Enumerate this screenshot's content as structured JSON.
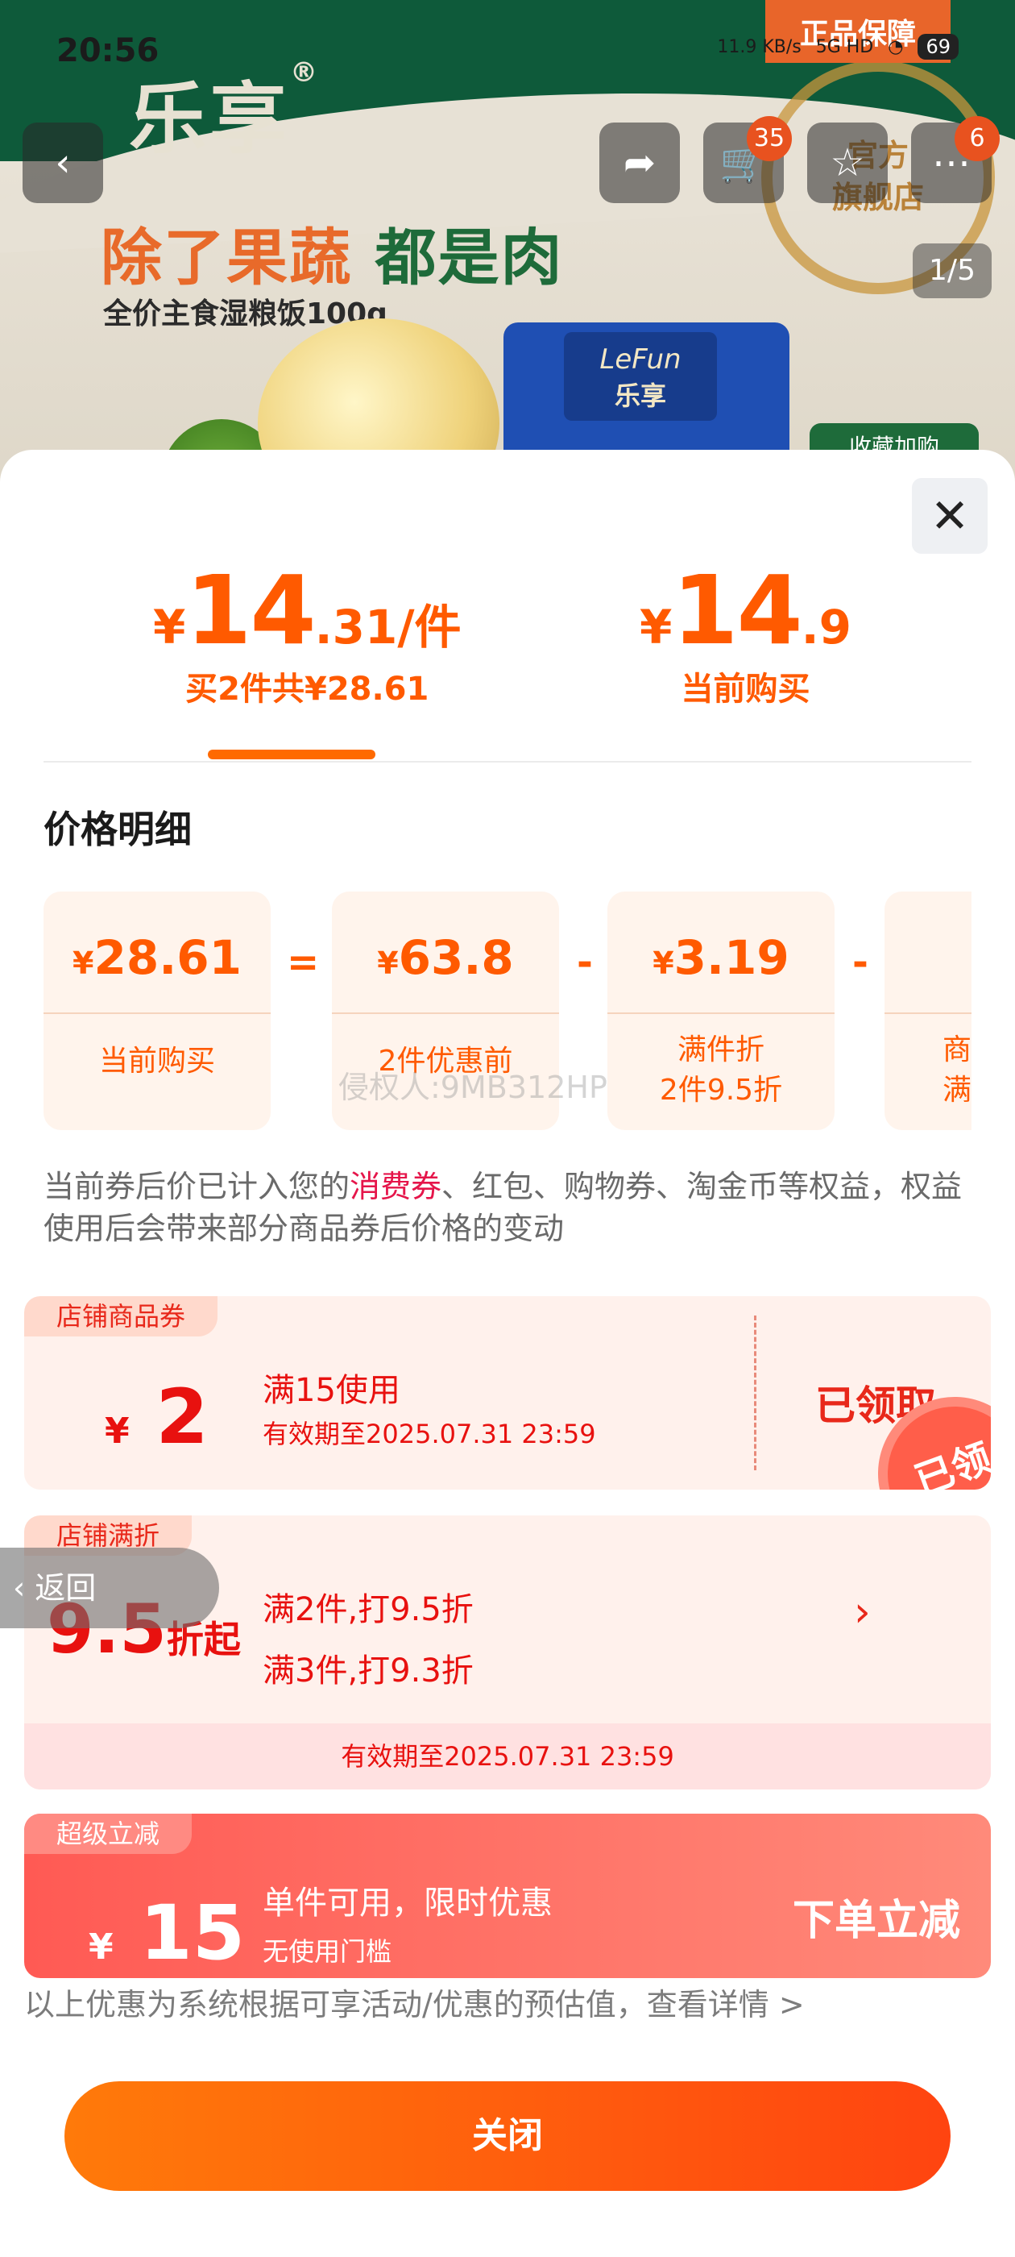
{
  "status_bar": {
    "time": "20:56",
    "net_speed": "11.9 KB/s",
    "signal": "5G HD",
    "battery": "69"
  },
  "banner": {
    "brand": "乐享",
    "brand_mark": "®",
    "headline_orange": "除了果蔬",
    "headline_green": "都是肉",
    "subtitle": "全价主食湿粮饭100g",
    "bag_brand_en": "LeFun",
    "bag_brand_cn": "乐享",
    "guarantee_tag": "正品保障",
    "seal_text_1": "官方",
    "seal_text_2": "旗舰店",
    "fav_tag": "收藏加购",
    "page_indicator": "1/5"
  },
  "nav": {
    "cart_count": "35",
    "more_count": "6"
  },
  "price_tabs": [
    {
      "yen": "¥",
      "int": "14",
      "dec": ".31/件",
      "caption": "买2件共¥28.61",
      "selected": true
    },
    {
      "yen": "¥",
      "int": "14",
      "dec": ".9",
      "caption": "当前购买",
      "selected": false
    }
  ],
  "price_detail": {
    "title": "价格明细",
    "cards": [
      {
        "yen": "¥",
        "value": "28.61",
        "label": "当前购买"
      },
      {
        "yen": "¥",
        "value": "63.8",
        "label": "2件优惠前"
      },
      {
        "yen": "¥",
        "value": "3.19",
        "label_1": "满件折",
        "label_2": "2件9.5折"
      },
      {
        "label_1": "商",
        "label_2": "满"
      }
    ],
    "operators": [
      "=",
      "-",
      "-"
    ],
    "watermark": "侵权人:9MB312HP"
  },
  "note": {
    "before": "当前券后价已计入您的",
    "highlight": "消费券",
    "after": "、红包、购物券、淘金币等权益，权益使用后会带来部分商品券后价格的变动"
  },
  "coupons": {
    "store_coupon": {
      "tag": "店铺商品券",
      "yen": "¥",
      "amount": "2",
      "condition": "满15使用",
      "expiry": "有效期至2025.07.31 23:59",
      "status": "已领取",
      "stamp": "已领"
    },
    "store_discount": {
      "tag": "店铺满折",
      "amount": "9.5",
      "unit": "折起",
      "rule_1": "满2件,打9.5折",
      "rule_2": "满3件,打9.3折",
      "expiry": "有效期至2025.07.31 23:59"
    },
    "super_discount": {
      "tag": "超级立减",
      "yen": "¥",
      "amount": "15",
      "condition": "单件可用，限时优惠",
      "sub": "无使用门槛",
      "action": "下单立减"
    }
  },
  "back_float": "返回",
  "disclaimer": "以上优惠为系统根据可享活动/优惠的预估值，查看详情 >",
  "close_button": "关闭",
  "colors": {
    "accent": "#ff5a00",
    "coupon_red": "#e8110f",
    "super_bg": "#ff6a5c"
  }
}
